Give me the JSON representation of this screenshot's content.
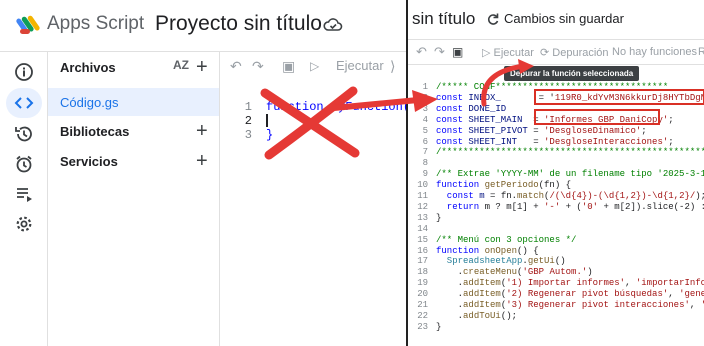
{
  "left": {
    "app_title": "Apps Script",
    "project_title": "Proyecto sin título",
    "files_section": "Archivos",
    "sort_label": "AZ",
    "file_name": "Código.gs",
    "libraries_section": "Bibliotecas",
    "services_section": "Servicios",
    "run_label": "Ejecutar",
    "line_numbers": [
      "1",
      "2",
      "3"
    ],
    "code_line1": "function myFunction() {",
    "code_line3": "}"
  },
  "right": {
    "title": "sin título",
    "unsaved": "Cambios sin guardar",
    "toolbar": {
      "run": "Ejecutar",
      "debug": "Depuración",
      "no_functions": "No hay funciones",
      "extra": "R"
    },
    "tooltip": "Depurar la función seleccionada",
    "lines": [
      {
        "n": "1",
        "parts": [
          [
            "c-com",
            "/***** CONF"
          ],
          [
            "c-com",
            "********************************"
          ]
        ]
      },
      {
        "n": "2",
        "parts": [
          [
            "c-kw",
            "const "
          ],
          [
            "c-var",
            "INBOX_"
          ],
          [
            "c-def",
            "       = '"
          ],
          [
            "c-str",
            "119R0_kdYvM3N6kkurDj8HYTbDgN1SmLF"
          ]
        ]
      },
      {
        "n": "3",
        "parts": [
          [
            "c-kw",
            "const "
          ],
          [
            "c-var",
            "DONE_ID"
          ]
        ]
      },
      {
        "n": "4",
        "parts": [
          [
            "c-kw",
            "const "
          ],
          [
            "c-var",
            "SHEET_MAIN"
          ],
          [
            "c-def",
            "  = "
          ],
          [
            "c-str",
            "'Informes GBP DaniCopy'"
          ],
          [
            "c-def",
            ";"
          ]
        ]
      },
      {
        "n": "5",
        "parts": [
          [
            "c-kw",
            "const "
          ],
          [
            "c-var",
            "SHEET_PIVOT"
          ],
          [
            "c-def",
            " = "
          ],
          [
            "c-str",
            "'DesgloseDinamico'"
          ],
          [
            "c-def",
            ";"
          ]
        ]
      },
      {
        "n": "6",
        "parts": [
          [
            "c-kw",
            "const "
          ],
          [
            "c-var",
            "SHEET_INT"
          ],
          [
            "c-def",
            "   = "
          ],
          [
            "c-str",
            "'DesgloseInteracciones'"
          ],
          [
            "c-def",
            ";"
          ]
        ]
      },
      {
        "n": "7",
        "parts": [
          [
            "c-com",
            "/*************************************************************"
          ]
        ]
      },
      {
        "n": "8",
        "parts": []
      },
      {
        "n": "9",
        "parts": [
          [
            "c-com",
            "/** Extrae 'YYYY-MM' de un filename tipo '2025-3-1…' */"
          ]
        ]
      },
      {
        "n": "10",
        "parts": [
          [
            "c-kw",
            "function "
          ],
          [
            "c-fn",
            "getPeriodo"
          ],
          [
            "c-def",
            "(fn) {"
          ]
        ]
      },
      {
        "n": "11",
        "parts": [
          [
            "c-kw",
            "  const "
          ],
          [
            "c-var",
            "m"
          ],
          [
            "c-def",
            " = fn."
          ],
          [
            "c-fn",
            "match"
          ],
          [
            "c-def",
            "("
          ],
          [
            "c-str",
            "/(\\d{4})-(\\d{1,2})-\\d{1,2}/"
          ],
          [
            "c-def",
            ");"
          ]
        ]
      },
      {
        "n": "12",
        "parts": [
          [
            "c-kw",
            "  return "
          ],
          [
            "c-def",
            "m ? m[1] + "
          ],
          [
            "c-str",
            "'-'"
          ],
          [
            "c-def",
            " + ("
          ],
          [
            "c-str",
            "'0'"
          ],
          [
            "c-def",
            " + m[2]).slice(-2) : null"
          ]
        ]
      },
      {
        "n": "13",
        "parts": [
          [
            "c-def",
            "}"
          ]
        ]
      },
      {
        "n": "14",
        "parts": []
      },
      {
        "n": "15",
        "parts": [
          [
            "c-com",
            "/** Menú con 3 opciones */"
          ]
        ]
      },
      {
        "n": "16",
        "parts": [
          [
            "c-kw",
            "function "
          ],
          [
            "c-fn",
            "onOpen"
          ],
          [
            "c-def",
            "() {"
          ]
        ]
      },
      {
        "n": "17",
        "parts": [
          [
            "c-cls",
            "  SpreadsheetApp"
          ],
          [
            "c-def",
            "."
          ],
          [
            "c-fn",
            "getUi"
          ],
          [
            "c-def",
            "()"
          ]
        ]
      },
      {
        "n": "18",
        "parts": [
          [
            "c-def",
            "    ."
          ],
          [
            "c-fn",
            "createMenu"
          ],
          [
            "c-def",
            "("
          ],
          [
            "c-str",
            "'GBP Autom.'"
          ],
          [
            "c-def",
            ")"
          ]
        ]
      },
      {
        "n": "19",
        "parts": [
          [
            "c-def",
            "    ."
          ],
          [
            "c-fn",
            "addItem"
          ],
          [
            "c-def",
            "("
          ],
          [
            "c-str",
            "'1) Importar informes'"
          ],
          [
            "c-def",
            ", "
          ],
          [
            "c-str",
            "'importarInformesG"
          ]
        ]
      },
      {
        "n": "20",
        "parts": [
          [
            "c-def",
            "    ."
          ],
          [
            "c-fn",
            "addItem"
          ],
          [
            "c-def",
            "("
          ],
          [
            "c-str",
            "'2) Regenerar pivot búsquedas'"
          ],
          [
            "c-def",
            ", "
          ],
          [
            "c-str",
            "'generarDe"
          ]
        ]
      },
      {
        "n": "21",
        "parts": [
          [
            "c-def",
            "    ."
          ],
          [
            "c-fn",
            "addItem"
          ],
          [
            "c-def",
            "("
          ],
          [
            "c-str",
            "'3) Regenerar pivot interacciones'"
          ],
          [
            "c-def",
            ", "
          ],
          [
            "c-str",
            "'gener"
          ]
        ]
      },
      {
        "n": "22",
        "parts": [
          [
            "c-def",
            "    ."
          ],
          [
            "c-fn",
            "addToUi"
          ],
          [
            "c-def",
            "();"
          ]
        ]
      },
      {
        "n": "23",
        "parts": [
          [
            "c-def",
            "}"
          ]
        ]
      }
    ]
  }
}
